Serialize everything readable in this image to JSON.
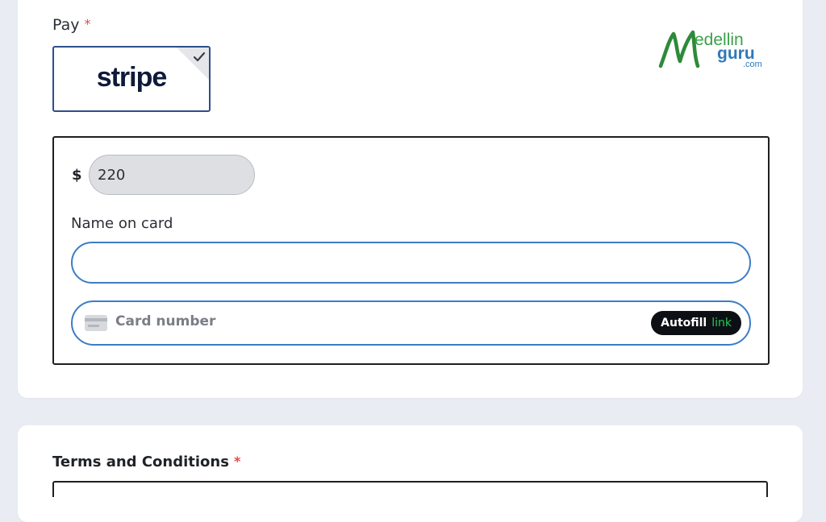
{
  "payment": {
    "label": "Pay",
    "required_marker": "*",
    "method": {
      "name": "stripe",
      "selected": true
    }
  },
  "logo": {
    "text_top": "edellin",
    "text_mid": "guru",
    "text_com": ".com"
  },
  "stripe_form": {
    "currency_symbol": "$",
    "amount_value": "220",
    "name_label": "Name on card",
    "name_value": "",
    "card_number_placeholder": "Card number",
    "autofill_label": "Autofill",
    "autofill_link": "link"
  },
  "terms": {
    "label": "Terms and Conditions",
    "required_marker": "*"
  },
  "colors": {
    "accent_border": "#3c7dc4",
    "required": "#e04a4a",
    "link_green": "#25c75b",
    "logo_green": "#3aa14a",
    "logo_blue": "#2f79b8"
  }
}
